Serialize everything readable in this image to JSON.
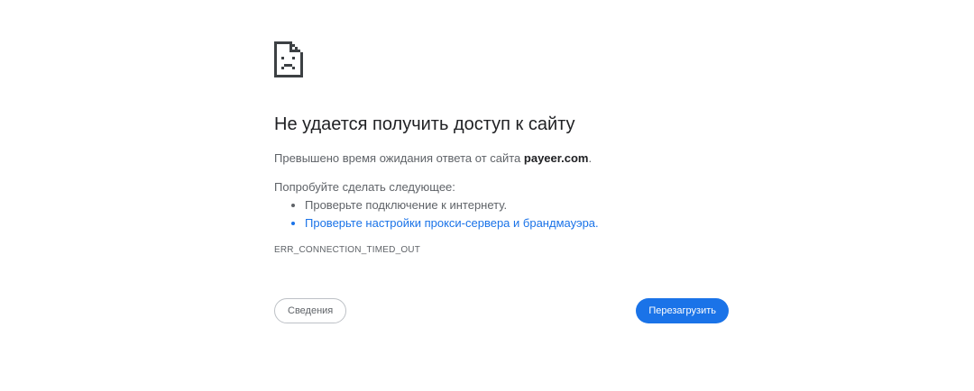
{
  "error": {
    "icon": "sad-page-icon",
    "title": "Не удается получить доступ к сайту",
    "summary_prefix": "Превышено время ожидания ответа от сайта ",
    "domain": "payeer.com",
    "summary_suffix": ".",
    "suggestions_heading": "Попробуйте сделать следующее:",
    "suggestions": [
      "Проверьте подключение к интернету.",
      "Проверьте настройки прокси-сервера и брандмауэра."
    ],
    "error_code": "ERR_CONNECTION_TIMED_OUT"
  },
  "buttons": {
    "details_label": "Сведения",
    "reload_label": "Перезагрузить"
  },
  "colors": {
    "accent": "#1a73e8",
    "text_primary": "#202124",
    "text_secondary": "#5f6368"
  }
}
